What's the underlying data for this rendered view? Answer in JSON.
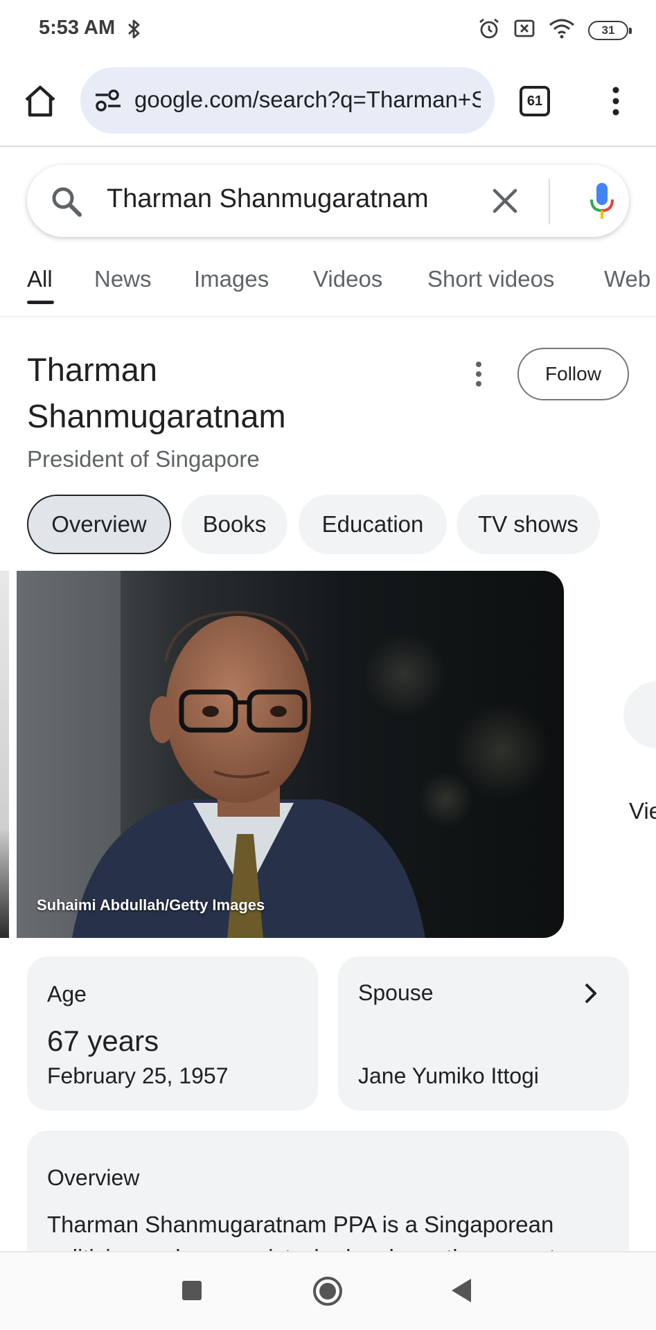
{
  "status_bar": {
    "time": "5:53 AM",
    "battery": "31",
    "icons": [
      "bluetooth-icon",
      "alarm-icon",
      "no-sim-icon",
      "wifi-icon",
      "battery-icon"
    ]
  },
  "browser": {
    "url": "google.com/search?q=Tharman+Shanmugaratnam",
    "tab_count": "61"
  },
  "search": {
    "query": "Tharman Shanmugaratnam"
  },
  "tabs": [
    {
      "label": "All",
      "active": true
    },
    {
      "label": "News"
    },
    {
      "label": "Images"
    },
    {
      "label": "Videos"
    },
    {
      "label": "Short videos"
    },
    {
      "label": "Web"
    }
  ],
  "knowledge_panel": {
    "title": "Tharman Shanmugaratnam",
    "subtitle": "President of Singapore",
    "follow_label": "Follow",
    "chips": [
      {
        "label": "Overview",
        "active": true
      },
      {
        "label": "Books"
      },
      {
        "label": "Education"
      },
      {
        "label": "TV shows"
      }
    ],
    "photo_credit": "Suhaimi Abdullah/Getty Images",
    "view_more_label": "View",
    "facts": {
      "age": {
        "label": "Age",
        "value": "67 years",
        "detail": "February 25, 1957"
      },
      "spouse": {
        "label": "Spouse",
        "value": "Jane Yumiko Ittogi"
      }
    },
    "overview": {
      "heading": "Overview",
      "text": "Tharman Shanmugaratnam PPA is a Singaporean politician and economist who has been the current"
    }
  },
  "colors": {
    "google_blue": "#4285f4",
    "google_red": "#ea4335",
    "google_yellow": "#fbbc05",
    "google_green": "#34a853",
    "url_bar_bg": "#e8ecf7",
    "card_bg": "#f1f3f4"
  }
}
